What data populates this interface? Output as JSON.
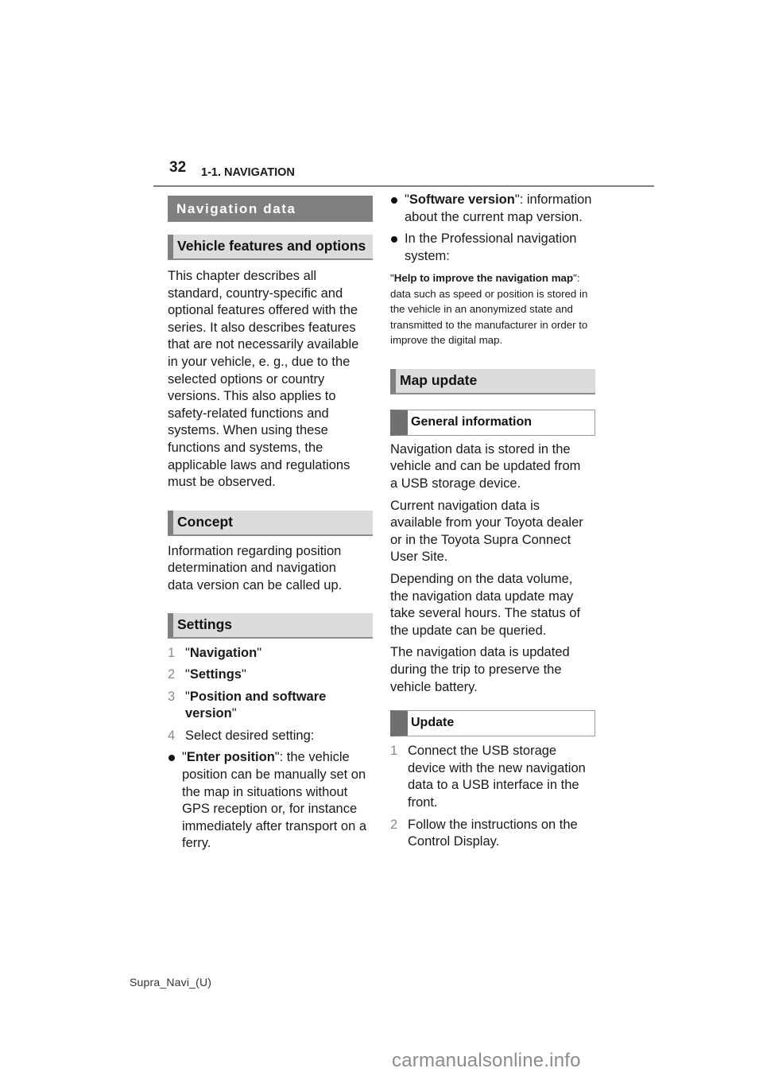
{
  "header": {
    "page_number": "32",
    "chapter": "1-1. NAVIGATION"
  },
  "left": {
    "section_title": "Navigation data",
    "vehicle_features": {
      "title": "Vehicle features and options",
      "body": "This chapter describes all standard, country-specific and optional features offered with the series. It also describes features that are not necessarily available in your vehicle, e. g., due to the selected options or country versions. This also applies to safety-related functions and systems. When using these functions and systems, the applicable laws and regulations must be observed."
    },
    "concept": {
      "title": "Concept",
      "body": "Information regarding position determination and navigation data version can be called up."
    },
    "settings": {
      "title": "Settings",
      "steps": [
        {
          "num": "1",
          "q1": "\"",
          "bold": "Navigation",
          "q2": "\"",
          "rest": ""
        },
        {
          "num": "2",
          "q1": "\"",
          "bold": "Settings",
          "q2": "\"",
          "rest": ""
        },
        {
          "num": "3",
          "q1": "\"",
          "bold": "Position and software version",
          "q2": "\"",
          "rest": ""
        },
        {
          "num": "4",
          "q1": "",
          "bold": "",
          "q2": "",
          "rest": "Select desired setting:"
        }
      ],
      "bullets": [
        {
          "q1": "\"",
          "bold": "Enter position",
          "q2": "\"",
          "rest": ": the vehicle position can be manually set on the map in situations without GPS reception or, for instance immediately after transport on a ferry."
        }
      ]
    }
  },
  "right": {
    "bullets": [
      {
        "q1": "\"",
        "bold": "Software version",
        "q2": "\"",
        "rest": ": information about the current map version."
      },
      {
        "q1": "",
        "bold": "",
        "q2": "",
        "rest": "In the Professional navigation system:"
      }
    ],
    "help_note": {
      "q1": "\"",
      "bold": "Help to improve the navigation map",
      "q2": "\"",
      "rest": ": data such as speed or position is stored in the vehicle in an anonymized state and transmitted to the manufacturer in order to improve the digital map."
    },
    "map_update": {
      "title": "Map update",
      "general": {
        "title": "General information",
        "paragraphs": [
          "Navigation data is stored in the vehicle and can be updated from a USB storage device.",
          "Current navigation data is available from your Toyota dealer or in the Toyota Supra Connect User Site.",
          "Depending on the data volume, the navigation data update may take several hours. The status of the update can be queried.",
          "The navigation data is updated during the trip to preserve the vehicle battery."
        ]
      },
      "update": {
        "title": "Update",
        "steps": [
          {
            "num": "1",
            "text": "Connect the USB storage device with the new navigation data to a USB interface in the front."
          },
          {
            "num": "2",
            "text": "Follow the instructions on the Control Display."
          }
        ]
      }
    }
  },
  "footer": {
    "code": "Supra_Navi_(U)",
    "watermark": "carmanualsonline.info"
  }
}
